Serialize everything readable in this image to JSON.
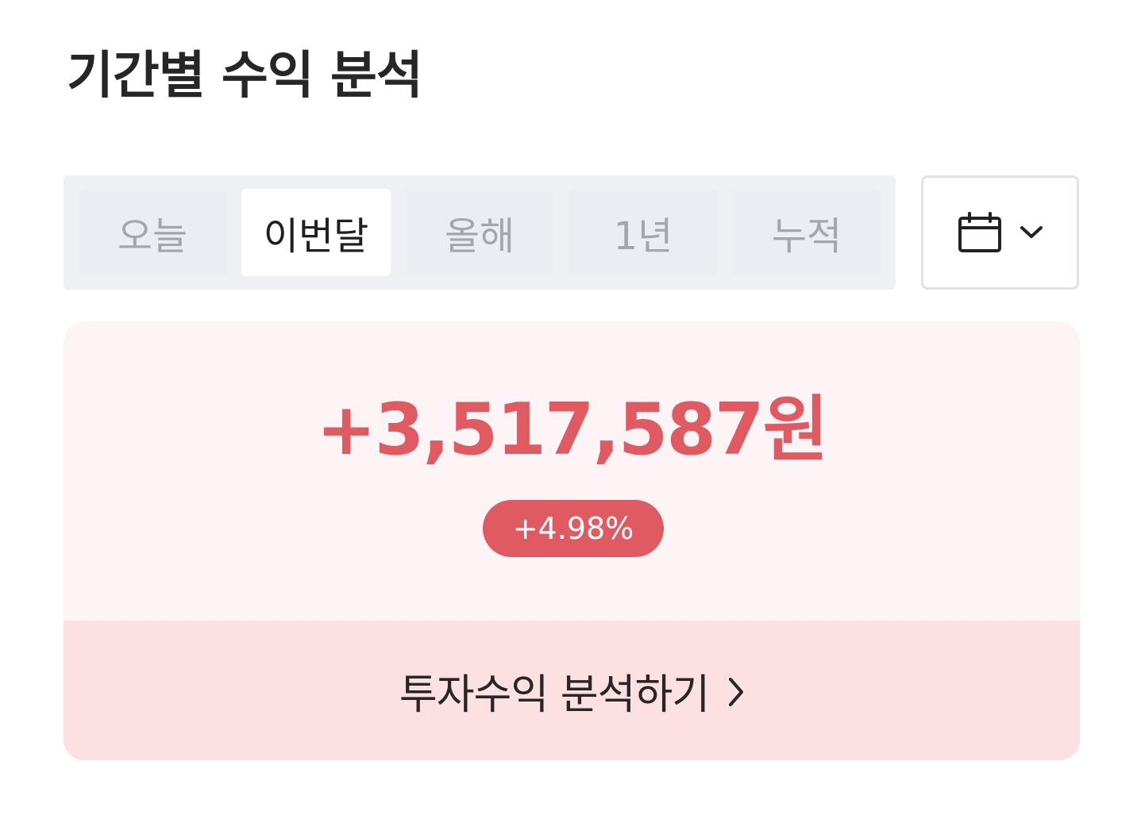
{
  "header": {
    "title": "기간별 수익 분석"
  },
  "period_tabs": [
    {
      "label": "오늘",
      "active": false
    },
    {
      "label": "이번달",
      "active": true
    },
    {
      "label": "올해",
      "active": false
    },
    {
      "label": "1년",
      "active": false
    },
    {
      "label": "누적",
      "active": false
    }
  ],
  "date_picker": {
    "icon": "calendar-icon",
    "chevron": "chevron-down-icon"
  },
  "summary": {
    "profit_amount": "+3,517,587원",
    "profit_rate": "+4.98%",
    "accent_color": "#e05a62"
  },
  "action": {
    "label": "투자수익 분석하기",
    "icon": "chevron-right-icon"
  }
}
